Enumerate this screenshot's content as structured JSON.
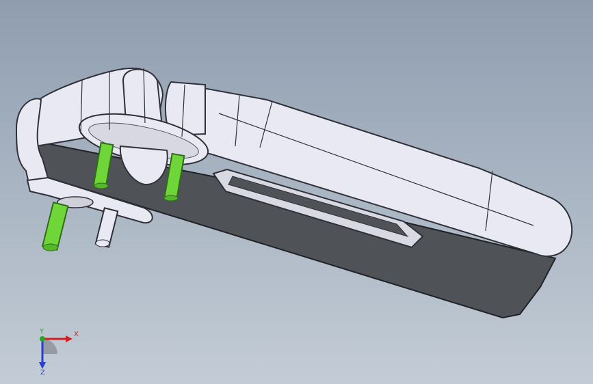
{
  "viewport": {
    "background_top": "#8f9daf",
    "background_bottom": "#c3ccd6"
  },
  "model": {
    "body_color": "#e9e9f3",
    "body_shadow_color": "#4f5257",
    "pin_color": "#6fd63a",
    "white_pin_color": "#e9e9f3"
  },
  "triad": {
    "x_label": "X",
    "y_label": "Y",
    "z_label": "Z",
    "x_color": "#d21f1f",
    "y_color": "#26a626",
    "z_color": "#2a3fc9"
  }
}
